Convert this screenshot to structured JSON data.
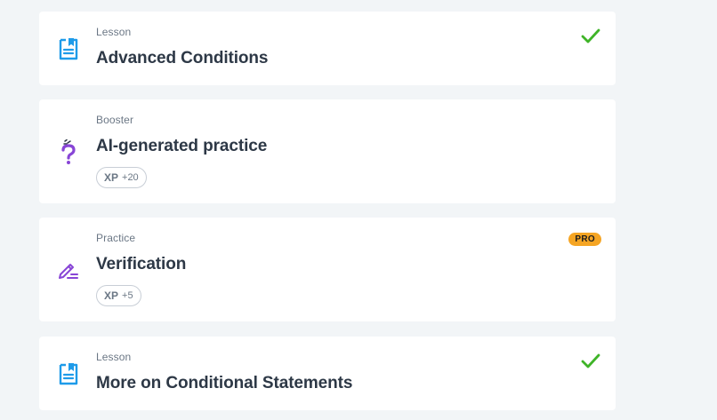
{
  "colors": {
    "background": "#f2f5f7",
    "card": "#ffffff",
    "lesson_icon": "#1e9be9",
    "booster_icon": "#8845d6",
    "practice_icon": "#8845d6",
    "check": "#3fb428",
    "pro_badge": "#f5a524"
  },
  "items": [
    {
      "type": "Lesson",
      "title": "Advanced Conditions",
      "icon": "lesson-document-icon",
      "completed": true
    },
    {
      "type": "Booster",
      "title": "AI-generated practice",
      "icon": "question-mark-icon",
      "xp_label": "XP",
      "xp_value": "+20"
    },
    {
      "type": "Practice",
      "title": "Verification",
      "icon": "pencil-edit-icon",
      "badge": "PRO",
      "xp_label": "XP",
      "xp_value": "+5"
    },
    {
      "type": "Lesson",
      "title": "More on Conditional Statements",
      "icon": "lesson-document-icon",
      "completed": true
    }
  ]
}
